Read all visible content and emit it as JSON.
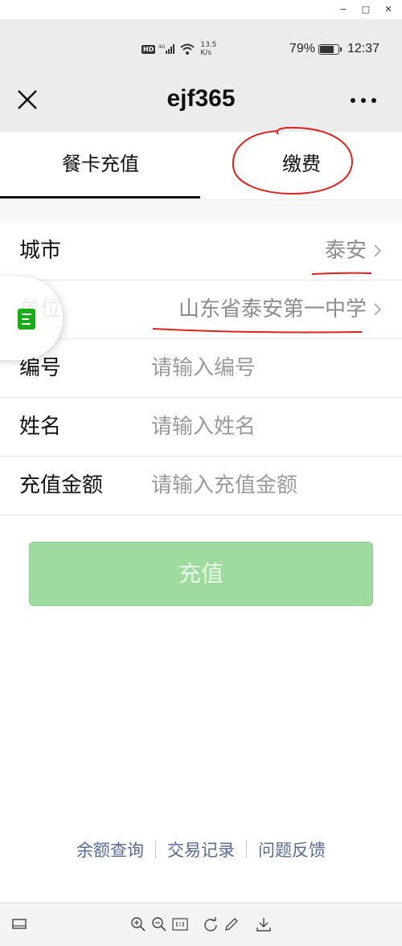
{
  "window": {
    "controls": [
      "−",
      "□",
      "✕"
    ]
  },
  "status_bar": {
    "hd": "HD",
    "net_speed_value": "13.5",
    "net_speed_unit": "K/s",
    "battery_percent": "79%",
    "battery_level": 0.79,
    "time": "12:37"
  },
  "nav": {
    "title": "ejf365",
    "close_icon": "close-icon",
    "more_icon": "more-icon"
  },
  "tabs": [
    {
      "label": "餐卡充值",
      "active": true
    },
    {
      "label": "缴费",
      "active": false
    }
  ],
  "form": {
    "city": {
      "label": "城市",
      "value": "泰安"
    },
    "unit": {
      "label": "单位",
      "value": "山东省泰安第一中学"
    },
    "number": {
      "label": "编号",
      "placeholder": "请输入编号"
    },
    "name": {
      "label": "姓名",
      "placeholder": "请输入姓名"
    },
    "amount": {
      "label": "充值金额",
      "placeholder": "请输入充值金额"
    }
  },
  "submit": {
    "label": "充值"
  },
  "footer_links": [
    "余额查询",
    "交易记录",
    "问题反馈"
  ],
  "colors": {
    "annotation": "#e0201a",
    "link": "#576b95",
    "button": "#9fdb9f"
  }
}
